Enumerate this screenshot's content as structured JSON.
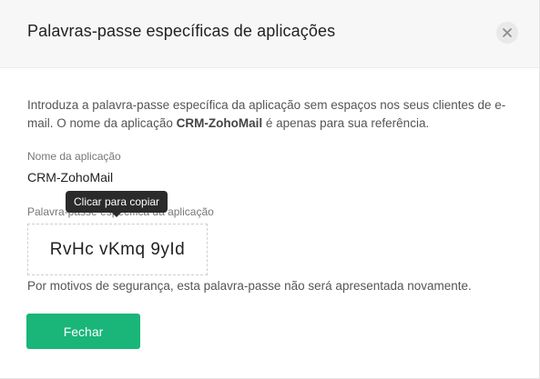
{
  "dialog": {
    "title": "Palavras-passe específicas de aplicações",
    "close_icon": "close-icon"
  },
  "intro": {
    "part1": "Introduza a palavra-passe específica da aplicação sem espaços nos seus clientes de e-mail. O nome da aplicação ",
    "app_name_bold": "CRM-ZohoMail",
    "part2": " é apenas para sua referência."
  },
  "app_name": {
    "label": "Nome da aplicação",
    "value": "CRM-ZohoMail"
  },
  "password": {
    "label": "Palavra-passe específica da aplicação",
    "value": "RvHc vKmq 9yId",
    "tooltip": "Clicar para copiar"
  },
  "security_note": "Por motivos de segurança, esta palavra-passe não será apresentada novamente.",
  "buttons": {
    "close_label": "Fechar"
  },
  "colors": {
    "accent": "#19b579",
    "header_bg": "#f7f7f7",
    "tooltip_bg": "#2b2b2b"
  }
}
